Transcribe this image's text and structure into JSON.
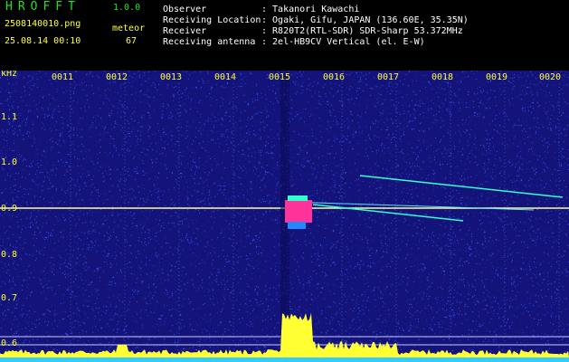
{
  "header": {
    "app_title": "HROFFT",
    "version": "1.0.0",
    "filename": "2508140010.png",
    "datetime": "25.08.14 00:10",
    "meteor_label": "meteor",
    "meteor_count": "67",
    "fields": [
      {
        "label": "Observer",
        "value": ": Takanori Kawachi"
      },
      {
        "label": "Receiving Location",
        "value": ": Ogaki, Gifu, JAPAN (136.60E, 35.35N)"
      },
      {
        "label": "Receiver",
        "value": ": R820T2(RTL-SDR) SDR-Sharp 53.372MHz"
      },
      {
        "label": "Receiving antenna",
        "value": ": 2el-HB9CV Vertical (el. E-W)"
      }
    ]
  },
  "spectrogram": {
    "unit": "kHz",
    "time_ticks": [
      "0011",
      "0012",
      "0013",
      "0014",
      "0015",
      "0016",
      "0017",
      "0018",
      "0019",
      "0020"
    ],
    "freq_ticks": [
      "1.1",
      "1.0",
      "0.9",
      "0.8",
      "0.7",
      "0.6"
    ],
    "colors": {
      "background": "#13137a",
      "signal": "#ffff33",
      "carrier": "#ffff88",
      "hot": "#ff3399",
      "trail": "#33ffcc"
    }
  }
}
